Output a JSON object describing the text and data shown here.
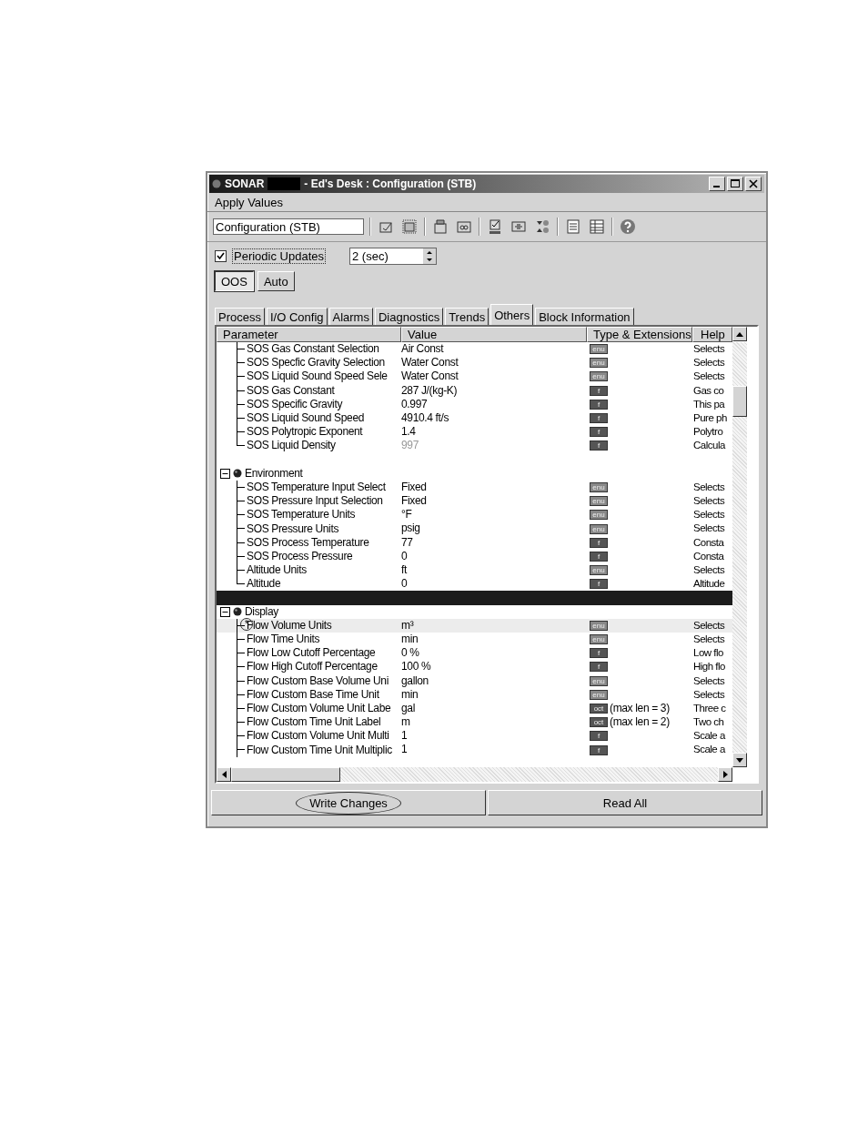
{
  "window": {
    "title": "SONAR",
    "title_rest": "- Ed's Desk : Configuration (STB)"
  },
  "menu": [
    "Apply Values"
  ],
  "toolbar": {
    "block_field": "Configuration (STB)"
  },
  "periodic_updates": {
    "label": "Periodic Updates",
    "checked": true,
    "interval": "2 (sec)"
  },
  "modes": [
    {
      "label": "OOS",
      "selected": true
    },
    {
      "label": "Auto",
      "selected": false
    }
  ],
  "tabs": [
    {
      "label": "Process",
      "selected": false
    },
    {
      "label": "I/O Config",
      "selected": false
    },
    {
      "label": "Alarms",
      "selected": false
    },
    {
      "label": "Diagnostics",
      "selected": false
    },
    {
      "label": "Trends",
      "selected": false
    },
    {
      "label": "Others",
      "selected": true
    },
    {
      "label": "Block Information",
      "selected": false
    }
  ],
  "table": {
    "columns": [
      "Parameter",
      "Value",
      "Type & Extensions",
      "Help"
    ],
    "rows": [
      {
        "kind": "param",
        "name": "SOS Gas Constant Selection",
        "value": "Air Const",
        "type": "enu",
        "help": "Selects",
        "selected": false,
        "dimmed": false,
        "last": false
      },
      {
        "kind": "param",
        "name": "SOS Specfic Gravity Selection",
        "value": "Water Const",
        "type": "enu",
        "help": "Selects",
        "selected": false,
        "dimmed": false,
        "last": false
      },
      {
        "kind": "param",
        "name": "SOS Liquid Sound Speed Sele",
        "value": "Water Const",
        "type": "enu",
        "help": "Selects",
        "selected": false,
        "dimmed": false,
        "last": false
      },
      {
        "kind": "param",
        "name": "SOS Gas Constant",
        "value": "287 J/(kg-K)",
        "type": "f",
        "help": "Gas co",
        "selected": false,
        "dimmed": false,
        "last": false
      },
      {
        "kind": "param",
        "name": "SOS Specific Gravity",
        "value": "0.997",
        "type": "f",
        "help": "This pa",
        "selected": false,
        "dimmed": false,
        "last": false
      },
      {
        "kind": "param",
        "name": "SOS Liquid Sound Speed",
        "value": "4910.4 ft/s",
        "type": "f",
        "help": "Pure ph",
        "selected": false,
        "dimmed": false,
        "last": false
      },
      {
        "kind": "param",
        "name": "SOS Polytropic Exponent",
        "value": "1.4",
        "type": "f",
        "help": "Polytro",
        "selected": false,
        "dimmed": false,
        "last": false
      },
      {
        "kind": "param",
        "name": "SOS Liquid Density",
        "value": "997",
        "type": "f",
        "help": "Calcula",
        "selected": false,
        "dimmed": true,
        "last": true
      },
      {
        "kind": "blank",
        "selected": false
      },
      {
        "kind": "group",
        "name": "Environment"
      },
      {
        "kind": "param",
        "name": "SOS Temperature Input Select",
        "value": "Fixed",
        "type": "enu",
        "help": "Selects",
        "selected": false,
        "dimmed": false,
        "last": false
      },
      {
        "kind": "param",
        "name": "SOS Pressure Input Selection",
        "value": "Fixed",
        "type": "enu",
        "help": "Selects",
        "selected": false,
        "dimmed": false,
        "last": false
      },
      {
        "kind": "param",
        "name": "SOS Temperature Units",
        "value": "°F",
        "type": "enu",
        "help": "Selects",
        "selected": false,
        "dimmed": false,
        "last": false
      },
      {
        "kind": "param",
        "name": "SOS Pressure Units",
        "value": "psig",
        "type": "enu",
        "help": "Selects",
        "selected": false,
        "dimmed": false,
        "last": false
      },
      {
        "kind": "param",
        "name": "SOS Process Temperature",
        "value": "77",
        "type": "f",
        "help": "Consta",
        "selected": false,
        "dimmed": false,
        "last": false
      },
      {
        "kind": "param",
        "name": "SOS Process Pressure",
        "value": "0",
        "type": "f",
        "help": "Consta",
        "selected": false,
        "dimmed": false,
        "last": false
      },
      {
        "kind": "param",
        "name": "Altitude Units",
        "value": "ft",
        "type": "enu",
        "help": "Selects",
        "selected": false,
        "dimmed": false,
        "last": false
      },
      {
        "kind": "param",
        "name": "Altitude",
        "value": "0",
        "type": "f",
        "help": "Altitude",
        "selected": false,
        "dimmed": false,
        "last": true
      },
      {
        "kind": "blank",
        "selected": true
      },
      {
        "kind": "group",
        "name": "Display"
      },
      {
        "kind": "param",
        "name": "Flow Volume Units",
        "value": "m³",
        "type": "enu",
        "help": "Selects",
        "selected": true,
        "dimmed": false,
        "last": false,
        "mark": "*"
      },
      {
        "kind": "param",
        "name": "Flow Time Units",
        "value": "min",
        "type": "enu",
        "help": "Selects",
        "selected": false,
        "dimmed": false,
        "last": false
      },
      {
        "kind": "param",
        "name": "Flow Low Cutoff Percentage",
        "value": "0 %",
        "type": "f",
        "help": "Low flo",
        "selected": false,
        "dimmed": false,
        "last": false
      },
      {
        "kind": "param",
        "name": "Flow High Cutoff Percentage",
        "value": "100 %",
        "type": "f",
        "help": "High flo",
        "selected": false,
        "dimmed": false,
        "last": false
      },
      {
        "kind": "param",
        "name": "Flow Custom Base Volume Uni",
        "value": "gallon",
        "type": "enu",
        "help": "Selects",
        "selected": false,
        "dimmed": false,
        "last": false
      },
      {
        "kind": "param",
        "name": "Flow Custom Base Time Unit",
        "value": "min",
        "type": "enu",
        "help": "Selects",
        "selected": false,
        "dimmed": false,
        "last": false
      },
      {
        "kind": "param",
        "name": "Flow Custom Volume Unit Labe",
        "value": "gal",
        "type": "oct",
        "ext": "(max len = 3)",
        "help": "Three c",
        "selected": false,
        "dimmed": false,
        "last": false
      },
      {
        "kind": "param",
        "name": "Flow Custom Time Unit Label",
        "value": "m",
        "type": "oct",
        "ext": "(max len = 2)",
        "help": "Two ch",
        "selected": false,
        "dimmed": false,
        "last": false
      },
      {
        "kind": "param",
        "name": "Flow Custom Volume Unit Multi",
        "value": "1",
        "type": "f",
        "help": "Scale a",
        "selected": false,
        "dimmed": false,
        "last": false
      },
      {
        "kind": "param",
        "name": "Flow Custom Time Unit Multiplic",
        "value": "1",
        "type": "f",
        "help": "Scale a",
        "selected": false,
        "dimmed": false,
        "last": false
      }
    ]
  },
  "buttons": [
    {
      "label": "Write Changes",
      "circled": true
    },
    {
      "label": "Read All",
      "circled": false
    }
  ]
}
